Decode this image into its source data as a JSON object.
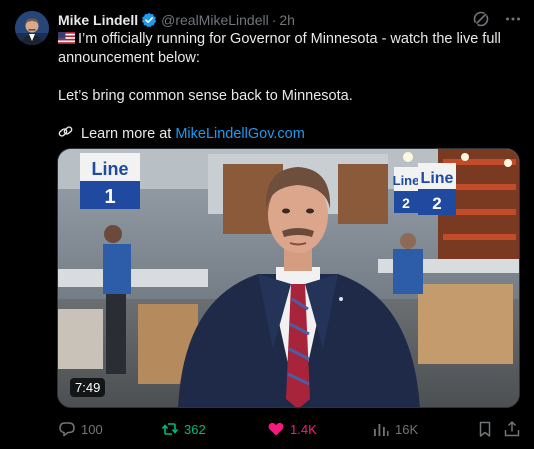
{
  "author": {
    "name": "Mike Lindell",
    "handle": "@realMikeLindell",
    "separator": "·",
    "time": "2h"
  },
  "body": {
    "line1": "I’m officially running for Governor of Minnesota - watch the live full announcement below:",
    "line2": "Let’s bring common sense back to Minnesota.",
    "learn_prefix": "Learn more at ",
    "link_text": "MikeLindellGov.com"
  },
  "media": {
    "duration": "7:49",
    "sign_left": "Line",
    "sign_left_num": "1",
    "sign_right_a": "Line",
    "sign_right_a_num": "2",
    "sign_right_b": "Line",
    "sign_right_b_num": "2"
  },
  "actions": {
    "replies": "100",
    "reposts": "362",
    "likes": "1.4K",
    "views": "16K"
  },
  "colors": {
    "accent": "#1d9bf0",
    "repost": "#00ba7c",
    "like": "#f91880",
    "muted": "#71767b"
  }
}
